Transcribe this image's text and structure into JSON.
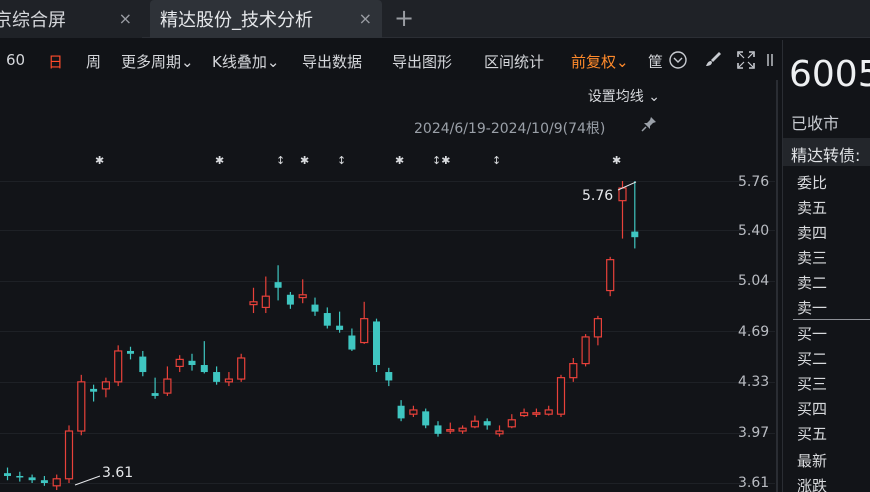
{
  "tabs": [
    {
      "label": "京综合屏",
      "close": "×"
    },
    {
      "label": "精达股份_技术分析",
      "close": "×"
    }
  ],
  "tab_add": "+",
  "toolbar": {
    "items": [
      "60",
      "日",
      "周",
      "更多周期",
      "K线叠加",
      "导出数据",
      "导出图形",
      "区间统计",
      "前复权",
      "筐"
    ],
    "dropdown_glyph": "⌄"
  },
  "chart": {
    "ma_setting": "设置均线",
    "range_label": "2024/6/19-2024/10/9(74根)",
    "price_ticks": [
      "5.76",
      "5.40",
      "5.04",
      "4.69",
      "4.33",
      "3.97",
      "3.61"
    ],
    "high_label": "5.76",
    "low_label": "3.61",
    "colors": {
      "up": "#e8413a",
      "down": "#3fc6c1",
      "bg": "#121418"
    }
  },
  "chart_data": {
    "type": "candlestick",
    "title": "",
    "ylim": [
      3.55,
      5.85
    ],
    "candles": [
      [
        3.68,
        3.66,
        3.72,
        3.63
      ],
      [
        3.66,
        3.65,
        3.69,
        3.62
      ],
      [
        3.65,
        3.63,
        3.67,
        3.61
      ],
      [
        3.63,
        3.61,
        3.66,
        3.59
      ],
      [
        3.59,
        3.64,
        3.67,
        3.56
      ],
      [
        3.64,
        3.98,
        4.02,
        3.61
      ],
      [
        3.98,
        4.33,
        4.38,
        3.95
      ],
      [
        4.28,
        4.26,
        4.31,
        4.19
      ],
      [
        4.28,
        4.33,
        4.36,
        4.22
      ],
      [
        4.33,
        4.55,
        4.59,
        4.3
      ],
      [
        4.55,
        4.53,
        4.58,
        4.49
      ],
      [
        4.51,
        4.4,
        4.55,
        4.37
      ],
      [
        4.25,
        4.23,
        4.36,
        4.21
      ],
      [
        4.25,
        4.35,
        4.44,
        4.23
      ],
      [
        4.44,
        4.49,
        4.52,
        4.4
      ],
      [
        4.48,
        4.45,
        4.53,
        4.41
      ],
      [
        4.45,
        4.4,
        4.62,
        4.39
      ],
      [
        4.4,
        4.33,
        4.44,
        4.31
      ],
      [
        4.33,
        4.35,
        4.4,
        4.3
      ],
      [
        4.35,
        4.5,
        4.53,
        4.33
      ],
      [
        4.88,
        4.9,
        5.0,
        4.82
      ],
      [
        4.86,
        4.94,
        5.08,
        4.82
      ],
      [
        5.04,
        5.0,
        5.16,
        4.91
      ],
      [
        4.95,
        4.88,
        4.97,
        4.85
      ],
      [
        4.93,
        4.95,
        5.06,
        4.89
      ],
      [
        4.88,
        4.83,
        4.93,
        4.8
      ],
      [
        4.82,
        4.73,
        4.86,
        4.71
      ],
      [
        4.73,
        4.7,
        4.83,
        4.68
      ],
      [
        4.66,
        4.56,
        4.71,
        4.55
      ],
      [
        4.61,
        4.78,
        4.9,
        4.6
      ],
      [
        4.76,
        4.45,
        4.78,
        4.4
      ],
      [
        4.4,
        4.34,
        4.43,
        4.3
      ],
      [
        4.16,
        4.07,
        4.2,
        4.05
      ],
      [
        4.1,
        4.13,
        4.16,
        4.08
      ],
      [
        4.12,
        4.02,
        4.14,
        4.0
      ],
      [
        4.02,
        3.96,
        4.05,
        3.94
      ],
      [
        3.98,
        3.99,
        4.04,
        3.96
      ],
      [
        3.98,
        4.0,
        4.02,
        3.96
      ],
      [
        4.01,
        4.05,
        4.09,
        4.0
      ],
      [
        4.05,
        4.02,
        4.07,
        3.99
      ],
      [
        3.96,
        3.98,
        4.02,
        3.94
      ],
      [
        4.01,
        4.06,
        4.1,
        4.0
      ],
      [
        4.09,
        4.11,
        4.14,
        4.08
      ],
      [
        4.1,
        4.11,
        4.14,
        4.08
      ],
      [
        4.1,
        4.13,
        4.16,
        4.09
      ],
      [
        4.1,
        4.36,
        4.38,
        4.08
      ],
      [
        4.36,
        4.46,
        4.5,
        4.33
      ],
      [
        4.46,
        4.65,
        4.67,
        4.44
      ],
      [
        4.65,
        4.78,
        4.8,
        4.59
      ],
      [
        4.98,
        5.2,
        5.22,
        4.94
      ],
      [
        5.62,
        5.71,
        5.76,
        5.35
      ],
      [
        5.4,
        5.36,
        5.76,
        5.28
      ]
    ]
  },
  "quote_panel": {
    "code": "6005",
    "status": "已收市",
    "bond": "精达转债:",
    "rows": [
      "委比",
      "卖五",
      "卖四",
      "卖三",
      "卖二",
      "卖一",
      "买一",
      "买二",
      "买三",
      "买四",
      "买五",
      "最新",
      "涨跌"
    ]
  }
}
